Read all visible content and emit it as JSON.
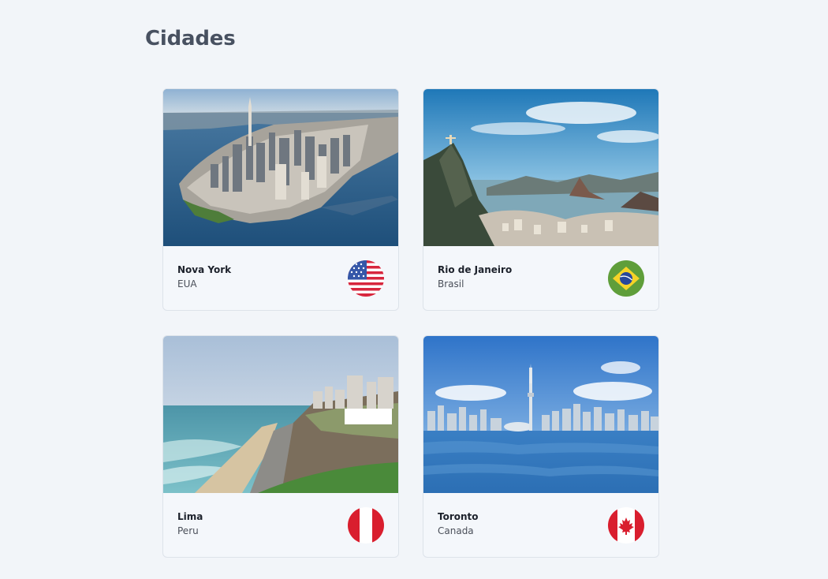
{
  "page": {
    "title": "Cidades"
  },
  "cities": [
    {
      "city": "Nova York",
      "country": "EUA",
      "flag_icon": "usa-flag-icon",
      "image": "new-york-skyline-photo"
    },
    {
      "city": "Rio de Janeiro",
      "country": "Brasil",
      "flag_icon": "brazil-flag-icon",
      "image": "rio-de-janeiro-landscape-photo"
    },
    {
      "city": "Lima",
      "country": "Peru",
      "flag_icon": "peru-flag-icon",
      "image": "lima-coastline-photo"
    },
    {
      "city": "Toronto",
      "country": "Canada",
      "flag_icon": "canada-flag-icon",
      "image": "toronto-skyline-photo"
    }
  ],
  "colors": {
    "background": "#f2f5f9",
    "title": "#485161",
    "card_border": "#dde3ea"
  }
}
